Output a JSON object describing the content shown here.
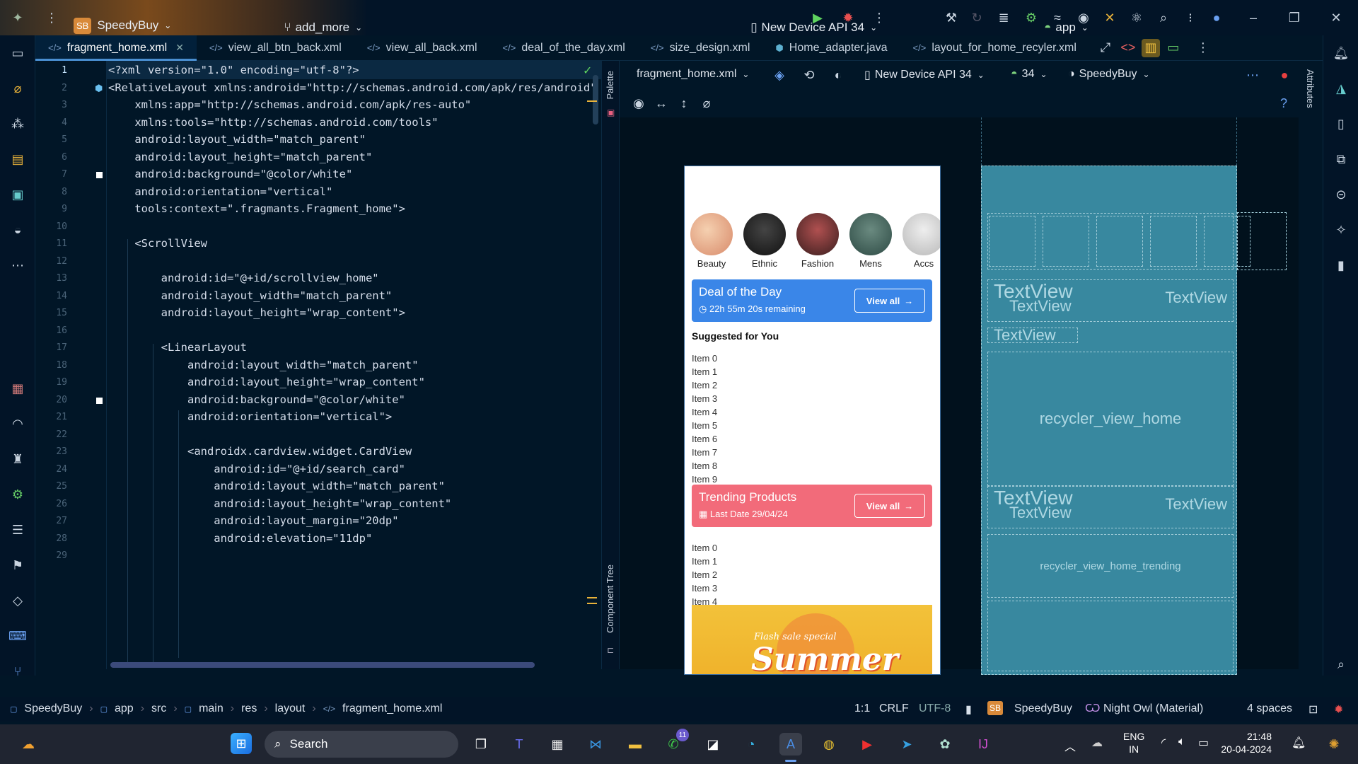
{
  "titlebar": {
    "project_badge": "SB",
    "project": "SpeedyBuy",
    "branch": "add_more",
    "device": "New Device API 34",
    "run_config": "app"
  },
  "tabs": [
    {
      "label": "fragment_home.xml",
      "active": true
    },
    {
      "label": "view_all_btn_back.xml"
    },
    {
      "label": "view_all_back.xml"
    },
    {
      "label": "deal_of_the_day.xml"
    },
    {
      "label": "size_design.xml"
    },
    {
      "label": "Home_adapter.java"
    },
    {
      "label": "layout_for_home_recyler.xml"
    }
  ],
  "editor": {
    "line_numbers": [
      "1",
      "2",
      "3",
      "4",
      "5",
      "6",
      "7",
      "8",
      "9",
      "10",
      "11",
      "12",
      "13",
      "14",
      "15",
      "16",
      "17",
      "18",
      "19",
      "20",
      "21",
      "22",
      "23",
      "24",
      "25",
      "26",
      "27",
      "28",
      "29"
    ],
    "lines": [
      "<?xml version=\"1.0\" encoding=\"utf-8\"?>",
      "<RelativeLayout xmlns:android=\"http://schemas.android.com/apk/res/android\"",
      "    xmlns:app=\"http://schemas.android.com/apk/res-auto\"",
      "    xmlns:tools=\"http://schemas.android.com/tools\"",
      "    android:layout_width=\"match_parent\"",
      "    android:layout_height=\"match_parent\"",
      "    android:background=\"@color/white\"",
      "    android:orientation=\"vertical\"",
      "    tools:context=\".fragmants.Fragment_home\">",
      "",
      "    <ScrollView",
      "",
      "        android:id=\"@+id/scrollview_home\"",
      "        android:layout_width=\"match_parent\"",
      "        android:layout_height=\"wrap_content\">",
      "",
      "        <LinearLayout",
      "            android:layout_width=\"match_parent\"",
      "            android:layout_height=\"wrap_content\"",
      "            android:background=\"@color/white\"",
      "            android:orientation=\"vertical\">",
      "",
      "            <androidx.cardview.widget.CardView",
      "                android:id=\"@+id/search_card\"",
      "                android:layout_width=\"match_parent\"",
      "                android:layout_height=\"wrap_content\"",
      "                android:layout_margin=\"20dp\"",
      "                android:elevation=\"11dp\"",
      ""
    ]
  },
  "side_labels": {
    "palette": "Palette",
    "component_tree": "Component Tree",
    "attributes": "Attributes"
  },
  "design_toolbar": {
    "file": "fragment_home.xml",
    "device": "New Device API 34",
    "api": "34",
    "theme": "SpeedyBuy"
  },
  "preview": {
    "categories": [
      "Beauty",
      "Ethnic",
      "Fashion",
      "Mens",
      "Accs"
    ],
    "deal": {
      "title": "Deal of the Day",
      "subtitle": "22h 55m 20s remaining",
      "button": "View all"
    },
    "suggested_title": "Suggested for You",
    "suggested_items": [
      "Item 0",
      "Item 1",
      "Item 2",
      "Item 3",
      "Item 4",
      "Item 5",
      "Item 6",
      "Item 7",
      "Item 8",
      "Item 9"
    ],
    "trending": {
      "title": "Trending Products",
      "subtitle": "Last Date 29/04/24",
      "button": "View all"
    },
    "trending_items": [
      "Item 0",
      "Item 1",
      "Item 2",
      "Item 3",
      "Item 4"
    ],
    "promo_small": "Flash sale special",
    "promo_big": "Summer"
  },
  "blueprint": {
    "textview": "TextView",
    "recycler": "recycler_view_home",
    "recycler_trending": "recycler_view_home_trending"
  },
  "statusbar": {
    "crumbs": [
      "SpeedyBuy",
      "app",
      "src",
      "main",
      "res",
      "layout",
      "fragment_home.xml"
    ],
    "position": "1:1",
    "line_sep": "CRLF",
    "encoding": "UTF-8",
    "project": "SpeedyBuy",
    "theme": "Night Owl (Material)",
    "indent": "4 spaces"
  },
  "taskbar": {
    "search": "Search",
    "whatsapp_badge": "11",
    "lang": "ENG",
    "region": "IN",
    "time": "21:48",
    "date": "20-04-2024"
  },
  "colors": {
    "deal_banner": "#3a86e8",
    "trending_banner": "#f26b7a",
    "blueprint": "#3b8fa6",
    "editor_bg": "#011627"
  }
}
